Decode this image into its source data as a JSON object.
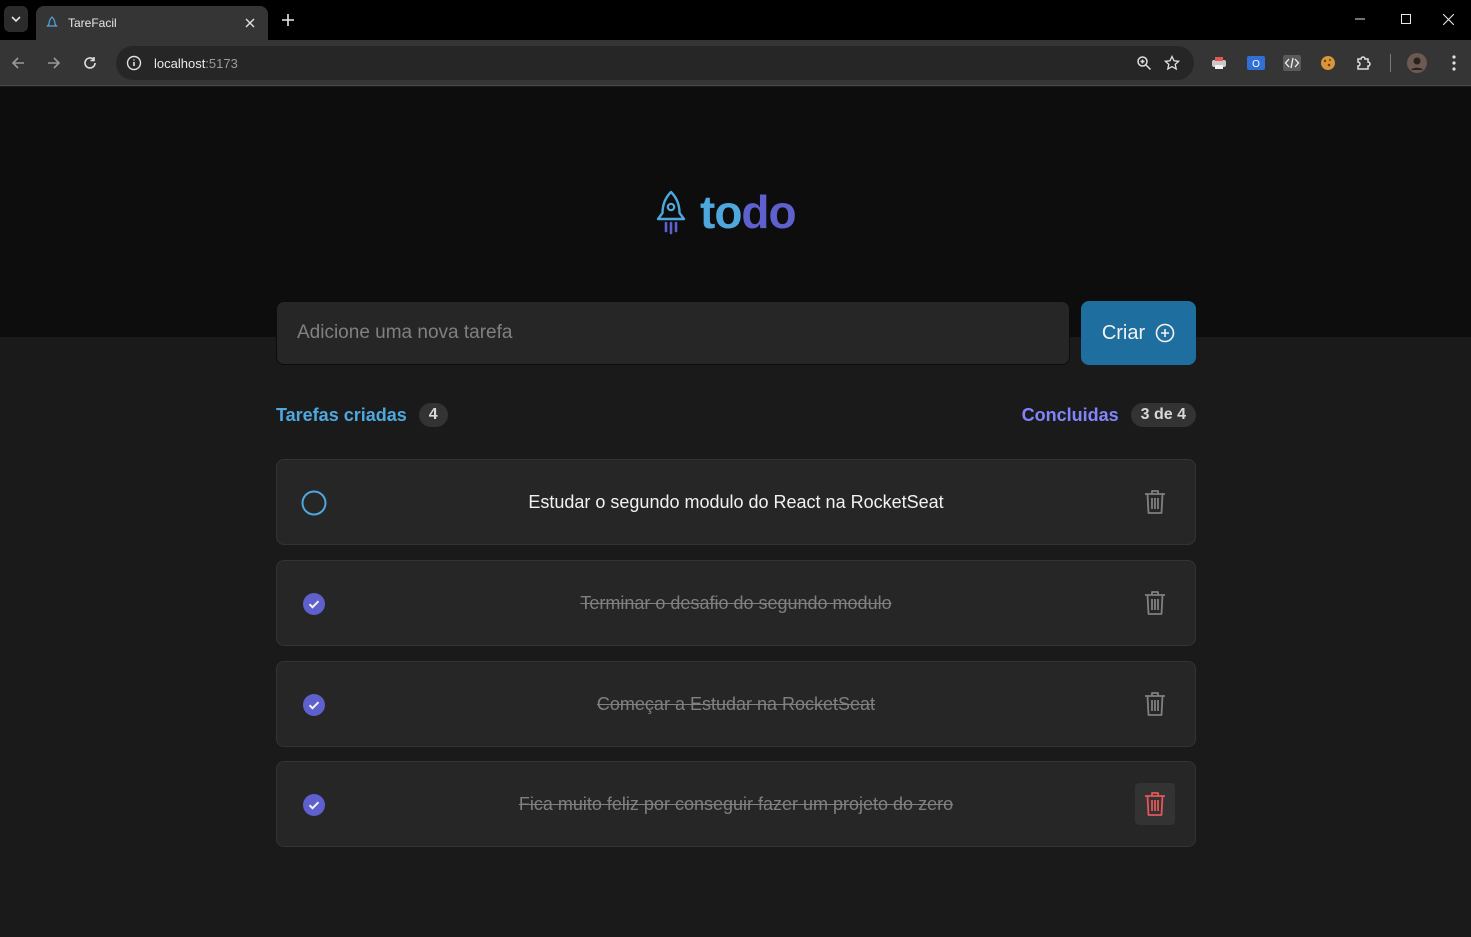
{
  "browser": {
    "tab_title": "TareFacil",
    "url_host": "localhost",
    "url_port": ":5173"
  },
  "app": {
    "logo_text_part1": "to",
    "logo_text_part2": "do",
    "input_placeholder": "Adicione uma nova tarefa",
    "create_label": "Criar",
    "created_label": "Tarefas criadas",
    "created_count": "4",
    "done_label": "Concluidas",
    "done_count": "3 de 4"
  },
  "tasks": [
    {
      "text": "Estudar o segundo modulo do React na RocketSeat",
      "done": false
    },
    {
      "text": "Terminar o desafio do segundo modulo",
      "done": true
    },
    {
      "text": "Começar a Estudar na RocketSeat",
      "done": true
    },
    {
      "text": "Fica muito feliz por conseguir fazer um projeto do zero",
      "done": true
    }
  ],
  "colors": {
    "blue": "#4ea8de",
    "purple": "#5e60ce",
    "purple_light": "#8284fa",
    "blue_dark": "#1e6f9f",
    "danger": "#e25858"
  }
}
